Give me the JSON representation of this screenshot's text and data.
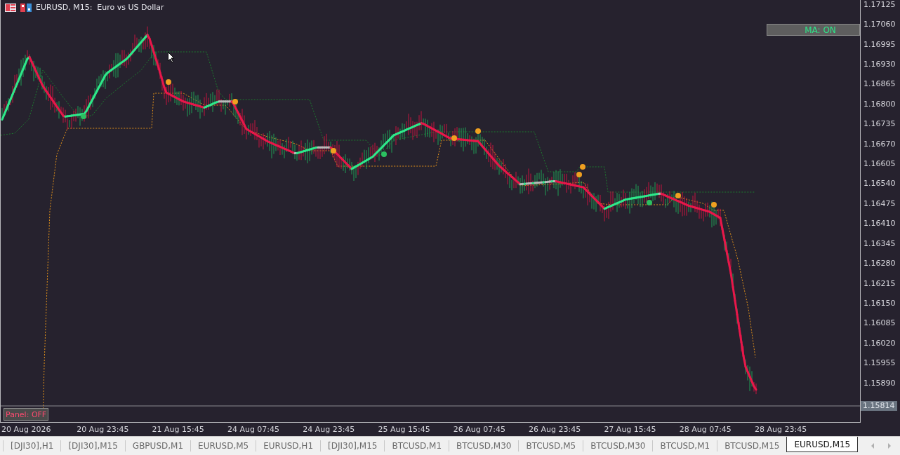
{
  "chart": {
    "title": "EURUSD, M15:  Euro vs US Dollar",
    "ma_button": "MA: ON",
    "panel_button": "Panel: OFF",
    "current_price": "1.15814",
    "price_labels": [
      "1.17125",
      "1.17060",
      "1.16995",
      "1.16930",
      "1.16865",
      "1.16800",
      "1.16735",
      "1.16670",
      "1.16605",
      "1.16540",
      "1.16475",
      "1.16410",
      "1.16345",
      "1.16280",
      "1.16215",
      "1.16150",
      "1.16085",
      "1.16020",
      "1.15955",
      "1.15890"
    ],
    "time_labels": [
      "20 Aug 2026",
      "20 Aug 23:45",
      "21 Aug 15:45",
      "24 Aug 07:45",
      "24 Aug 23:45",
      "25 Aug 15:45",
      "26 Aug 07:45",
      "26 Aug 23:45",
      "27 Aug 15:45",
      "28 Aug 07:45",
      "28 Aug 23:45"
    ]
  },
  "tabs": [
    {
      "label": "[DJI30],H1",
      "selected": false
    },
    {
      "label": "[DJI30],M15",
      "selected": false
    },
    {
      "label": "GBPUSD,M1",
      "selected": false
    },
    {
      "label": "EURUSD,M5",
      "selected": false
    },
    {
      "label": "EURUSD,H1",
      "selected": false
    },
    {
      "label": "[DJI30],M15",
      "selected": false
    },
    {
      "label": "BTCUSD,M1",
      "selected": false
    },
    {
      "label": "BTCUSD,M30",
      "selected": false
    },
    {
      "label": "BTCUSD,M5",
      "selected": false
    },
    {
      "label": "BTCUSD,M30",
      "selected": false
    },
    {
      "label": "BTCUSD,M1",
      "selected": false
    },
    {
      "label": "BTCUSD,M15",
      "selected": false
    },
    {
      "label": "EURUSD,M15",
      "selected": true
    }
  ]
}
